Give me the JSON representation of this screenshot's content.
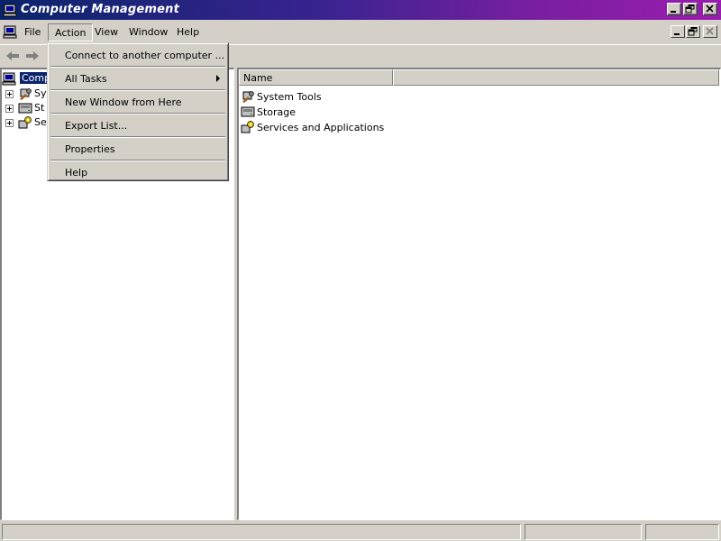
{
  "window": {
    "title": "Computer Management",
    "controls": [
      "minimize",
      "restore",
      "close"
    ]
  },
  "menubar": {
    "items": [
      {
        "label": "File"
      },
      {
        "label": "Action"
      },
      {
        "label": "View"
      },
      {
        "label": "Window"
      },
      {
        "label": "Help"
      }
    ]
  },
  "toolbar": {
    "buttons": [
      "back-arrow-icon",
      "forward-arrow-icon"
    ]
  },
  "tree": {
    "root": "Compu",
    "children": [
      {
        "label": "Sy",
        "icon": "system-tools-icon"
      },
      {
        "label": "St",
        "icon": "storage-icon"
      },
      {
        "label": "Se",
        "icon": "services-icon"
      }
    ]
  },
  "list": {
    "column_name": "Name",
    "items": [
      {
        "label": "System Tools",
        "icon": "system-tools-icon"
      },
      {
        "label": "Storage",
        "icon": "storage-icon"
      },
      {
        "label": "Services and Applications",
        "icon": "services-icon"
      }
    ]
  },
  "action_menu": {
    "connect": "Connect to another computer ...",
    "all_tasks": "All Tasks",
    "new_window": "New Window from Here",
    "export_list": "Export List...",
    "properties": "Properties",
    "help": "Help"
  },
  "statusbar": {
    "panels": [
      "",
      "",
      ""
    ]
  },
  "colors": {
    "title_start": "#0a246a",
    "title_end": "#9a1cb0",
    "selection": "#0a246a",
    "face": "#d4d0c8"
  }
}
